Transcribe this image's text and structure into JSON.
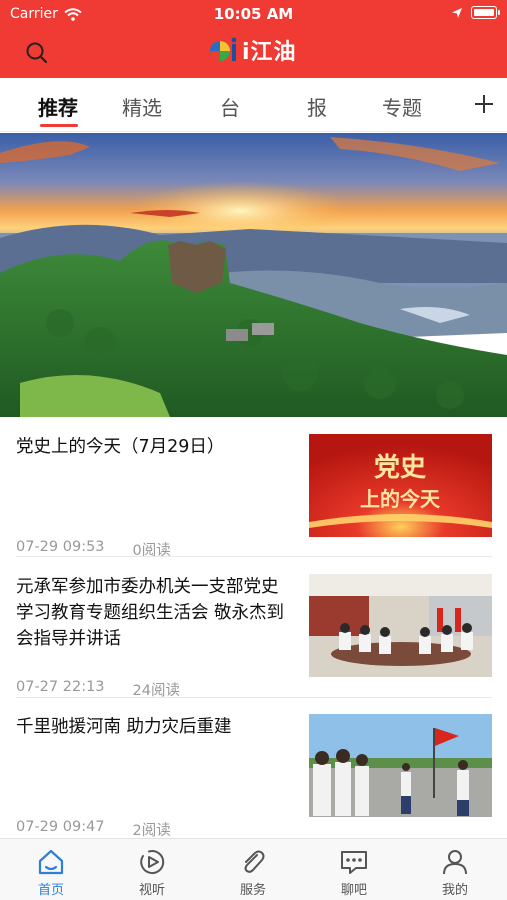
{
  "status_bar": {
    "carrier": "Carrier",
    "time": "10:05 AM"
  },
  "header": {
    "app_name": "i江油",
    "search_icon": "search-icon"
  },
  "tabs": [
    {
      "label": "推荐",
      "active": true
    },
    {
      "label": "精选",
      "active": false
    },
    {
      "label": "台",
      "active": false
    },
    {
      "label": "报",
      "active": false
    },
    {
      "label": "专题",
      "active": false
    }
  ],
  "tabs_add_icon": "plus-icon",
  "hero": {
    "description_icon": "landscape-image"
  },
  "articles": [
    {
      "title": "党史上的今天（7月29日）",
      "date": "07-29 09:53",
      "reads": "0阅读",
      "thumb_line1": "党史",
      "thumb_line2": "上的今天"
    },
    {
      "title": "元承军参加市委办机关一支部党史学习教育专题组织生活会 敬永杰到会指导并讲话",
      "date": "07-27 22:13",
      "reads": "24阅读"
    },
    {
      "title": "千里驰援河南 助力灾后重建",
      "date": "07-29 09:47",
      "reads": "2阅读"
    }
  ],
  "bottom_nav": [
    {
      "label": "首页",
      "icon": "home-icon",
      "active": true
    },
    {
      "label": "视听",
      "icon": "video-icon",
      "active": false
    },
    {
      "label": "服务",
      "icon": "service-icon",
      "active": false
    },
    {
      "label": "聊吧",
      "icon": "chat-icon",
      "active": false
    },
    {
      "label": "我的",
      "icon": "profile-icon",
      "active": false
    }
  ],
  "colors": {
    "brand_red": "#ef3b33",
    "active_blue": "#2f7fd8",
    "meta_gray": "#999999"
  }
}
